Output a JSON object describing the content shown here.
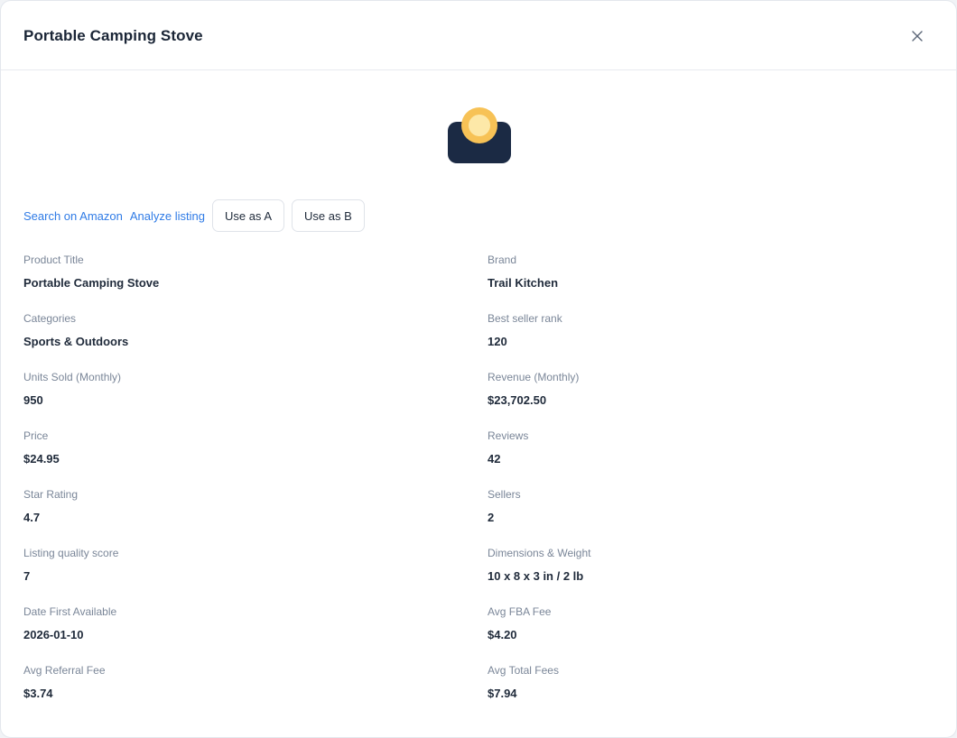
{
  "modal": {
    "title": "Portable Camping Stove"
  },
  "icons": {
    "close": "close-icon",
    "product": "camping-stove-icon"
  },
  "colors": {
    "link": "#2f7be6",
    "product_body": "#1b2a44",
    "product_flame_outer": "#f7c256",
    "product_flame_inner": "#fde8a8"
  },
  "actions": {
    "search_link": "Search on Amazon",
    "analyze_link": "Analyze listing",
    "use_a_label": "Use as A",
    "use_b_label": "Use as B"
  },
  "fields": [
    {
      "label": "Product Title",
      "value": "Portable Camping Stove"
    },
    {
      "label": "Brand",
      "value": "Trail Kitchen"
    },
    {
      "label": "Categories",
      "value": "Sports & Outdoors"
    },
    {
      "label": "Best seller rank",
      "value": "120"
    },
    {
      "label": "Units Sold (Monthly)",
      "value": "950"
    },
    {
      "label": "Revenue (Monthly)",
      "value": "$23,702.50"
    },
    {
      "label": "Price",
      "value": "$24.95"
    },
    {
      "label": "Reviews",
      "value": "42"
    },
    {
      "label": "Star Rating",
      "value": "4.7"
    },
    {
      "label": "Sellers",
      "value": "2"
    },
    {
      "label": "Listing quality score",
      "value": "7"
    },
    {
      "label": "Dimensions & Weight",
      "value": "10 x 8 x 3 in / 2 lb"
    },
    {
      "label": "Date First Available",
      "value": "2026-01-10"
    },
    {
      "label": "Avg FBA Fee",
      "value": "$4.20"
    },
    {
      "label": "Avg Referral Fee",
      "value": "$3.74"
    },
    {
      "label": "Avg Total Fees",
      "value": "$7.94"
    }
  ]
}
